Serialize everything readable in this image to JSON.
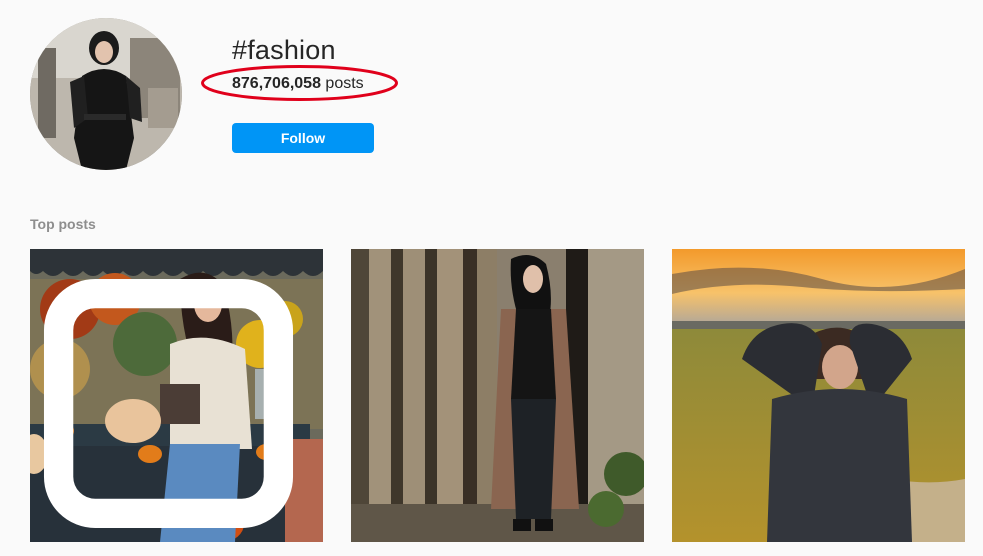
{
  "header": {
    "hashtag": "#fashion",
    "post_count": "876,706,058",
    "post_count_suffix": " posts",
    "follow_label": "Follow"
  },
  "top_posts": {
    "label": "Top posts",
    "posts": [
      {
        "icon": "carousel-icon"
      },
      {},
      {}
    ]
  },
  "colors": {
    "follow_button": "#0095f6",
    "highlight_ellipse": "#e0001b",
    "section_label": "#8e8e8e"
  }
}
